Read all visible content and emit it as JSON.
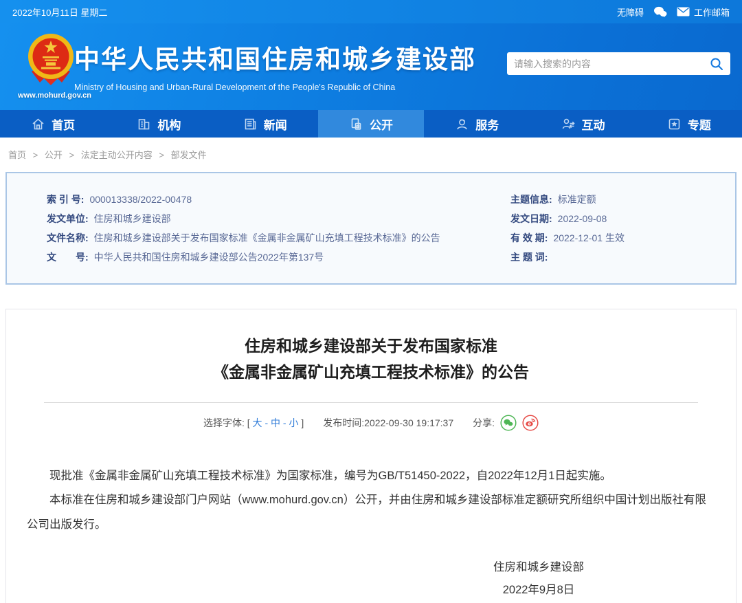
{
  "topbar": {
    "date": "2022年10月11日 星期二",
    "accessibility_label": "无障碍",
    "mailbox_label": "工作邮箱"
  },
  "header": {
    "site_title": "中华人民共和国住房和城乡建设部",
    "site_subtitle": "Ministry of Housing and Urban-Rural Development of the People's Republic of China",
    "site_url": "www.mohurd.gov.cn",
    "search_placeholder": "请输入搜索的内容"
  },
  "nav": {
    "items": [
      {
        "label": "首页",
        "icon": "home-icon",
        "active": false
      },
      {
        "label": "机构",
        "icon": "org-icon",
        "active": false
      },
      {
        "label": "新闻",
        "icon": "news-icon",
        "active": false
      },
      {
        "label": "公开",
        "icon": "open-icon",
        "active": true
      },
      {
        "label": "服务",
        "icon": "service-icon",
        "active": false
      },
      {
        "label": "互动",
        "icon": "interact-icon",
        "active": false
      },
      {
        "label": "专题",
        "icon": "topic-icon",
        "active": false
      }
    ]
  },
  "breadcrumb": {
    "items": [
      "首页",
      "公开",
      "法定主动公开内容",
      "部发文件"
    ],
    "separator": ">"
  },
  "infobox": {
    "left": [
      {
        "label": "索 引 号:",
        "value": "000013338/2022-00478"
      },
      {
        "label": "发文单位:",
        "value": "住房和城乡建设部"
      },
      {
        "label": "文件名称:",
        "value": "住房和城乡建设部关于发布国家标准《金属非金属矿山充填工程技术标准》的公告"
      },
      {
        "label": "文　　号:",
        "value": "中华人民共和国住房和城乡建设部公告2022年第137号"
      }
    ],
    "right": [
      {
        "label": "主题信息:",
        "value": "标准定额"
      },
      {
        "label": "发文日期:",
        "value": "2022-09-08"
      },
      {
        "label": "有 效 期:",
        "value": "2022-12-01 生效"
      },
      {
        "label": "主 题 词:",
        "value": ""
      }
    ]
  },
  "article": {
    "title_line1": "住房和城乡建设部关于发布国家标准",
    "title_line2": "《金属非金属矿山充填工程技术标准》的公告",
    "font_label": "选择字体:",
    "bracket_open": "[",
    "bracket_close": "]",
    "font_dash": "-",
    "font_sizes": [
      "大",
      "中",
      "小"
    ],
    "publish_label": "发布时间:",
    "publish_time": "2022-09-30 19:17:37",
    "share_label": "分享:",
    "paragraphs": [
      "现批准《金属非金属矿山充填工程技术标准》为国家标准，编号为GB/T51450-2022，自2022年12月1日起实施。",
      "本标准在住房和城乡建设部门户网站（www.mohurd.gov.cn）公开，并由住房和城乡建设部标准定额研究所组织中国计划出版社有限公司出版发行。"
    ],
    "signature": [
      "住房和城乡建设部",
      "2022年9月8日"
    ]
  },
  "colors": {
    "header_blue": "#0e7fe2",
    "nav_blue": "#0a5ec4",
    "nav_active_blue": "#3189dd",
    "link_blue": "#2f7bd8",
    "infobox_border": "#aac6e6",
    "infobox_bg": "#f7fafd",
    "label_navy": "#33497f",
    "wechat_green": "#4eb655",
    "weibo_red": "#e64a45"
  }
}
